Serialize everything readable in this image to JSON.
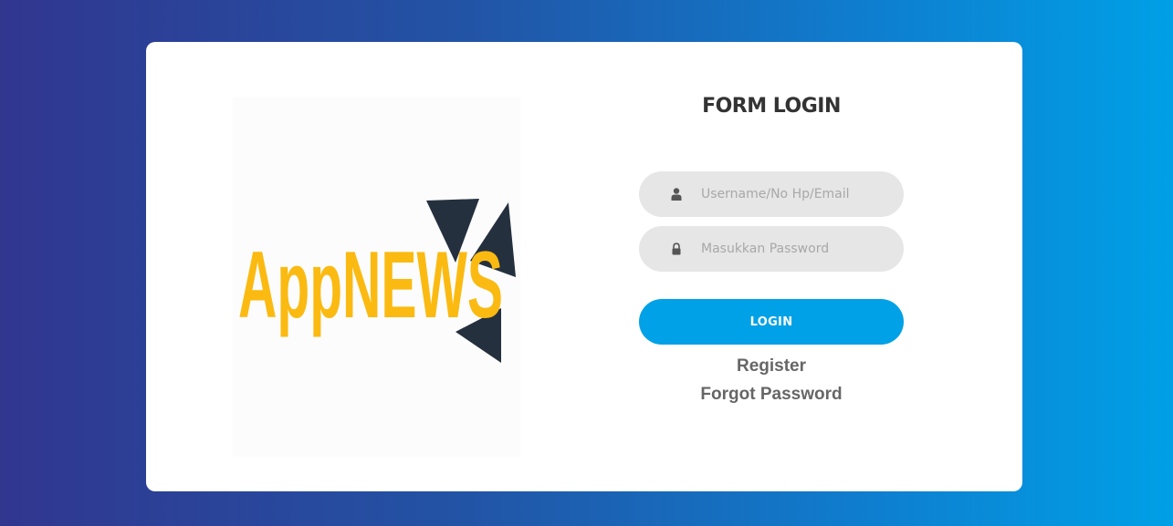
{
  "logo": {
    "text": "AppNEWS",
    "text_color": "#fbba11",
    "shape_color": "#25303f"
  },
  "form": {
    "title": "FORM LOGIN",
    "username": {
      "placeholder": "Username/No Hp/Email",
      "value": "",
      "icon": "user-icon"
    },
    "password": {
      "placeholder": "Masukkan Password",
      "value": "",
      "icon": "lock-icon"
    },
    "login_label": "LOGIN",
    "register_label": "Register",
    "forgot_label": "Forgot Password"
  },
  "colors": {
    "background_gradient": [
      "#31368f",
      "#00a0e6"
    ],
    "button": "#00a1e6",
    "field_bg": "#e6e6e6"
  }
}
